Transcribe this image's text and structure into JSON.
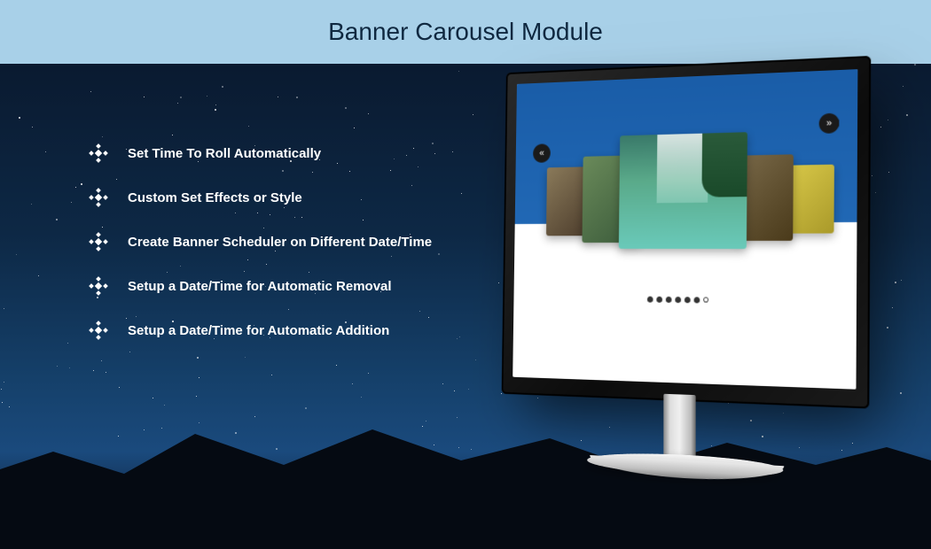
{
  "header": {
    "title": "Banner Carousel Module"
  },
  "features": [
    {
      "label": "Set Time To Roll Automatically"
    },
    {
      "label": "Custom Set Effects or Style"
    },
    {
      "label": "Create Banner Scheduler on Different Date/Time"
    },
    {
      "label": "Setup a Date/Time for Automatic Removal"
    },
    {
      "label": "Setup a Date/Time for  Automatic Addition"
    }
  ],
  "carousel": {
    "prev_icon": "«",
    "next_icon": "»",
    "dot_count": 7,
    "active_dot": 6
  }
}
